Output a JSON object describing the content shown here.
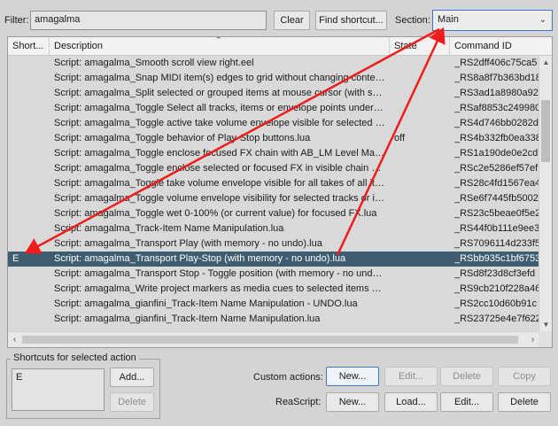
{
  "filter": {
    "label": "Filter:",
    "value": "amagalma"
  },
  "toolbar": {
    "clear_label": "Clear",
    "find_shortcut_label": "Find shortcut..."
  },
  "section": {
    "label": "Section:",
    "value": "Main"
  },
  "columns": {
    "shortcut": "Short...",
    "description": "Description",
    "state": "State",
    "command_id": "Command ID"
  },
  "rows": [
    {
      "shortcut": "",
      "description": "Script: amagalma_Smooth scroll view right.eel",
      "state": "",
      "command_id": "_RS2dff406c75ca5"
    },
    {
      "shortcut": "",
      "description": "Script: amagalma_Snap MIDI item(s) edges to grid without changing content ...",
      "state": "",
      "command_id": "_RS8a8f7b363bd18"
    },
    {
      "shortcut": "",
      "description": "Script: amagalma_Split selected or grouped items at mouse cursor (with sele...",
      "state": "",
      "command_id": "_RS3ad1a8980a92"
    },
    {
      "shortcut": "",
      "description": "Script: amagalma_Toggle Select all tracks, items or envelope points under m...",
      "state": "",
      "command_id": "_RSaf8853c249980"
    },
    {
      "shortcut": "",
      "description": "Script: amagalma_Toggle active take volume envelope visible for selected it...",
      "state": "",
      "command_id": "_RS4d746bb0282d"
    },
    {
      "shortcut": "",
      "description": "Script: amagalma_Toggle behavior of Play-Stop buttons.lua",
      "state": "off",
      "command_id": "_RS4b332fb0ea338"
    },
    {
      "shortcut": "",
      "description": "Script: amagalma_Toggle enclose focused FX chain with AB_LM Level Mat...",
      "state": "",
      "command_id": "_RS1a190de0e2cd"
    },
    {
      "shortcut": "",
      "description": "Script: amagalma_Toggle enclose selected or focused FX in visible chain wit...",
      "state": "",
      "command_id": "_RSc2e5286ef57ef"
    },
    {
      "shortcut": "",
      "description": "Script: amagalma_Toggle take volume envelope visible for all takes of all ite...",
      "state": "",
      "command_id": "_RS28c4fd1567ea4"
    },
    {
      "shortcut": "",
      "description": "Script: amagalma_Toggle volume envelope visibility for selected tracks or ite...",
      "state": "",
      "command_id": "_RSe6f7445fb5002"
    },
    {
      "shortcut": "",
      "description": "Script: amagalma_Toggle wet 0-100% (or current value) for focused FX.lua",
      "state": "",
      "command_id": "_RS23c5beae0f5e2"
    },
    {
      "shortcut": "",
      "description": "Script: amagalma_Track-Item Name Manipulation.lua",
      "state": "",
      "command_id": "_RS44f0b111e9ee3"
    },
    {
      "shortcut": "",
      "description": "Script: amagalma_Transport Play (with memory - no undo).lua",
      "state": "",
      "command_id": "_RS7096114d233f5"
    },
    {
      "shortcut": "E",
      "description": "Script: amagalma_Transport Play-Stop (with memory - no undo).lua",
      "state": "",
      "command_id": "_RSbb935c1bf6753",
      "selected": true
    },
    {
      "shortcut": "",
      "description": "Script: amagalma_Transport Stop - Toggle position (with memory - no undo).lua",
      "state": "",
      "command_id": "_RSd8f23d8cf3efd"
    },
    {
      "shortcut": "",
      "description": "Script: amagalma_Write project markers as media cues to selected items acti...",
      "state": "",
      "command_id": "_RS9cb210f228a46"
    },
    {
      "shortcut": "",
      "description": "Script: amagalma_gianfini_Track-Item Name Manipulation - UNDO.lua",
      "state": "",
      "command_id": "_RS2cc10d60b91c"
    },
    {
      "shortcut": "",
      "description": "Script: amagalma_gianfini_Track-Item Name Manipulation.lua",
      "state": "",
      "command_id": "_RS23725e4e7f622"
    }
  ],
  "shortcuts_panel": {
    "title": "Shortcuts for selected action",
    "items": [
      "E"
    ],
    "add_label": "Add...",
    "delete_label": "Delete"
  },
  "custom_actions": {
    "label": "Custom actions:",
    "new_label": "New...",
    "edit_label": "Edit...",
    "delete_label": "Delete",
    "copy_label": "Copy"
  },
  "reascript": {
    "label": "ReaScript:",
    "new_label": "New...",
    "load_label": "Load...",
    "edit_label": "Edit...",
    "delete_label": "Delete"
  },
  "colors": {
    "selection": "#3f5d70",
    "focus": "#3b78c6",
    "annotation_arrow": "#ee1c1c"
  }
}
